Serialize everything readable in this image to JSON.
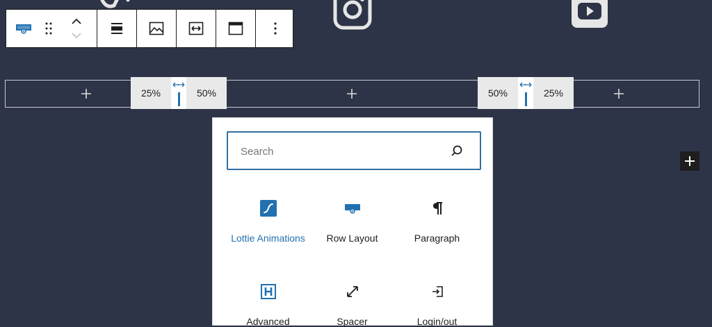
{
  "toolbar": {
    "block_icon": "row-layout-icon",
    "drag_icon": "drag-handle-icon",
    "move_up_icon": "chevron-up-icon",
    "move_down_icon": "chevron-down-icon",
    "align_icon": "align-center-icon",
    "media_icon": "image-icon",
    "width_icon": "full-width-icon",
    "layout_icon": "header-layout-icon",
    "more_icon": "more-vertical-icon"
  },
  "row_layout": {
    "resizers": [
      {
        "left": "25%",
        "right": "50%"
      },
      {
        "left": "50%",
        "right": "25%"
      }
    ]
  },
  "inserter": {
    "search_placeholder": "Search",
    "blocks": [
      {
        "label": "Lottie Animations",
        "icon": "lottie-icon"
      },
      {
        "label": "Row Layout",
        "icon": "row-layout-icon"
      },
      {
        "label": "Paragraph",
        "icon": "paragraph-icon"
      },
      {
        "label": "Advanced",
        "icon": "heading-icon"
      },
      {
        "label": "Spacer",
        "icon": "resize-arrows-icon"
      },
      {
        "label": "Login/out",
        "icon": "login-icon"
      }
    ]
  },
  "colors": {
    "background": "#2d3447",
    "accent": "#2271b1",
    "toolbar_border": "#1e1e1e"
  }
}
